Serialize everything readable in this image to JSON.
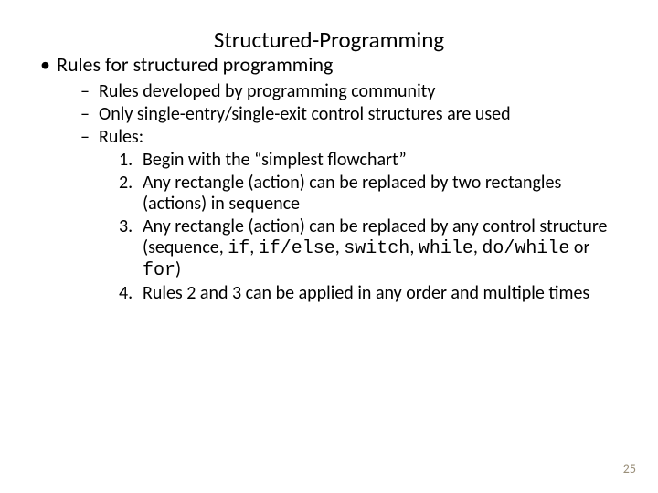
{
  "title": "Structured-Programming",
  "bullet_char": "•",
  "dash_char": "–",
  "level1": "Rules for structured programming",
  "level2": {
    "a": "Rules developed by programming community",
    "b": "Only single-entry/single-exit control structures are used",
    "c": "Rules:"
  },
  "rules": {
    "r1": {
      "n": "1.",
      "t": "Begin with the “simplest flowchart”"
    },
    "r2": {
      "n": "2.",
      "t": "Any rectangle (action) can be replaced by two rectangles (actions) in sequence"
    },
    "r3": {
      "n": "3.",
      "pre": "Any rectangle (action) can be replaced by any control structure (sequence, ",
      "c_if": "if",
      "sep1": ", ",
      "c_ifelse": "if/else",
      "sep2": ", ",
      "c_switch": "switch",
      "sep3": ", ",
      "c_while": "while",
      "sep4": ", ",
      "c_dowhile": "do/while",
      "or": " or ",
      "c_for": "for",
      "post": ")"
    },
    "r4": {
      "n": "4.",
      "t": "Rules 2 and 3 can be applied in any order and multiple times"
    }
  },
  "page_number": "25"
}
